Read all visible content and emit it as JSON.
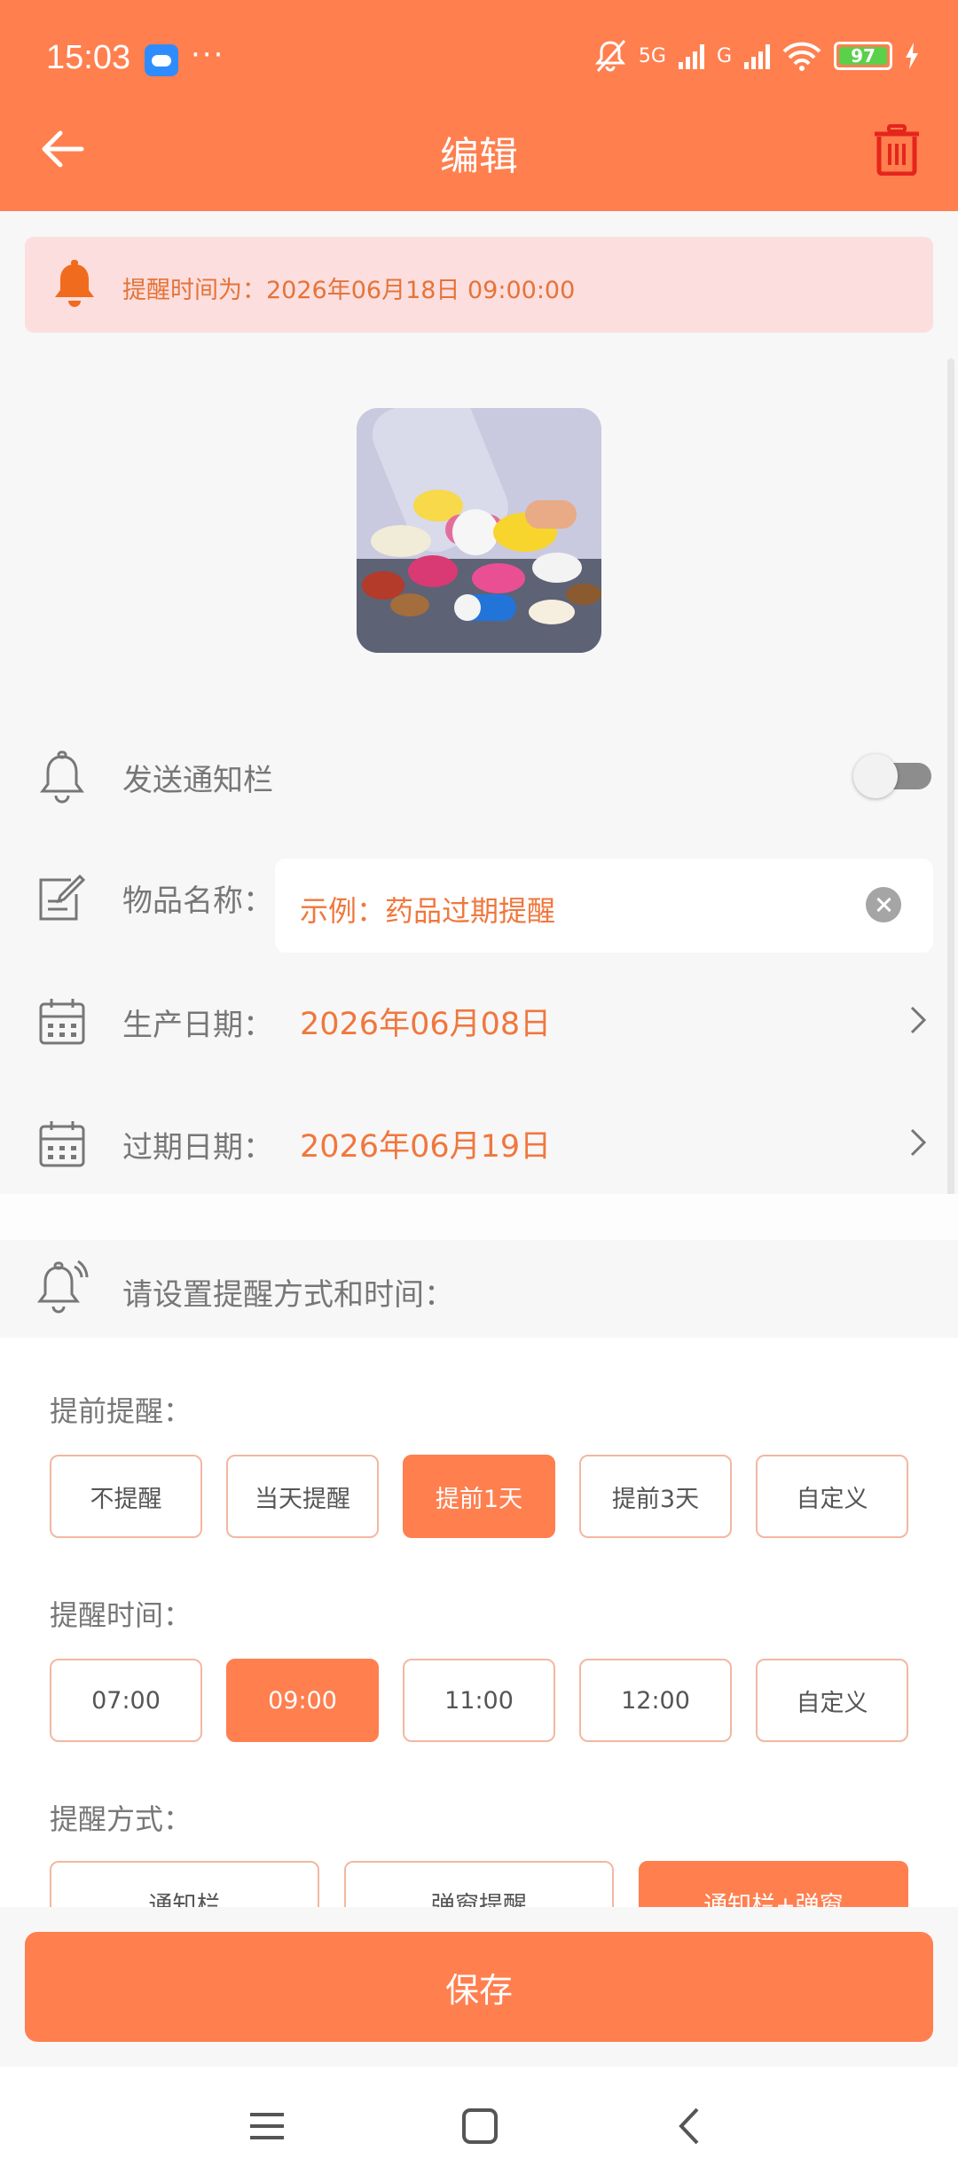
{
  "status_bar": {
    "time": "15:03",
    "dots": "···",
    "network": "5G",
    "network2": "G",
    "battery": "97"
  },
  "header": {
    "title": "编辑"
  },
  "banner": {
    "text": "提醒时间为：2026年06月18日 09:00:00"
  },
  "fields": {
    "notify": {
      "label": "发送通知栏",
      "enabled": false
    },
    "name": {
      "label": "物品名称：",
      "placeholder": "示例：药品过期提醒"
    },
    "production_date": {
      "label": "生产日期：",
      "value": "2026年06月08日"
    },
    "expiry_date": {
      "label": "过期日期：",
      "value": "2026年06月19日"
    }
  },
  "remind": {
    "heading": "请设置提醒方式和时间：",
    "advance": {
      "title": "提前提醒：",
      "options": [
        "不提醒",
        "当天提醒",
        "提前1天",
        "提前3天",
        "自定义"
      ],
      "selected": "提前1天"
    },
    "time": {
      "title": "提醒时间：",
      "options": [
        "07:00",
        "09:00",
        "11:00",
        "12:00",
        "自定义"
      ],
      "selected": "09:00"
    },
    "method": {
      "title": "提醒方式：",
      "options": [
        "通知栏",
        "弹窗提醒",
        "通知栏+弹窗"
      ],
      "selected": "通知栏+弹窗"
    }
  },
  "actions": {
    "save": "保存"
  },
  "colors": {
    "accent": "#ff7f4f",
    "value_text": "#f0773d",
    "banner_bg": "#fcdede"
  }
}
